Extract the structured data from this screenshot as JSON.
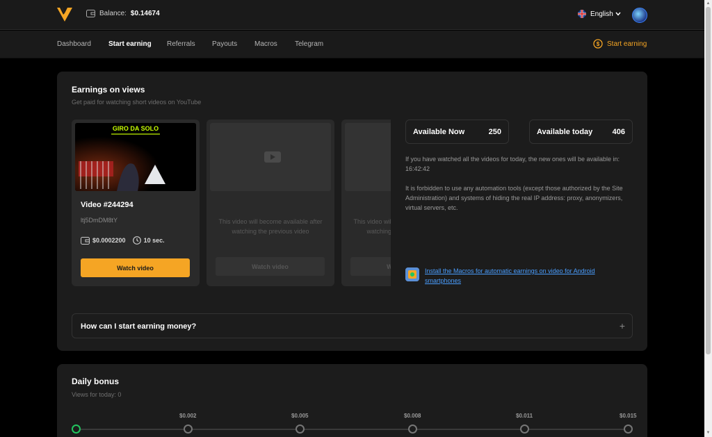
{
  "header": {
    "balance_label": "Balance:",
    "balance_value": "$0.14674",
    "language": "English"
  },
  "nav": {
    "items": [
      {
        "label": "Dashboard",
        "active": false
      },
      {
        "label": "Start earning",
        "active": true
      },
      {
        "label": "Referrals",
        "active": false
      },
      {
        "label": "Payouts",
        "active": false
      },
      {
        "label": "Macros",
        "active": false
      },
      {
        "label": "Telegram",
        "active": false
      }
    ],
    "cta_label": "Start earning"
  },
  "earnings": {
    "title": "Earnings on views",
    "subtitle": "Get paid for watching short videos on YouTube",
    "videos": [
      {
        "thumb_text": "GIRO DA SOLO",
        "title": "Video #244294",
        "id": "ltj5DmDM8tY",
        "reward": "$0.0002200",
        "duration": "10 sec.",
        "button": "Watch video"
      },
      {
        "locked_text": "This video will become available after watching the previous video",
        "button": "Watch video"
      },
      {
        "locked_text": "This video will become available after watching the previous video",
        "button": "Watch video"
      }
    ],
    "available_now_label": "Available Now",
    "available_now_value": "250",
    "available_today_label": "Available today",
    "available_today_value": "406",
    "info_next": "If you have watched all the videos for today, the new ones will be available in: 16:42:42",
    "info_forbidden": "It is forbidden to use any automation tools (except those authorized by the Site Administration) and systems of hiding the real IP address: proxy, anonymizers, virtual servers, etc.",
    "macros_link": "Install the Macros for automatic earnings on video for Android smartphones",
    "faq_question": "How can I start earning money?",
    "faq_plus": "+"
  },
  "bonus": {
    "title": "Daily bonus",
    "subtitle": "Views for today: 0",
    "steps": [
      "$0.002",
      "$0.005",
      "$0.008",
      "$0.011",
      "$0.015"
    ]
  },
  "colors": {
    "accent": "#f5a524",
    "link": "#4a9eff",
    "done": "#22c55e",
    "card_bg": "#1c1c1c"
  }
}
